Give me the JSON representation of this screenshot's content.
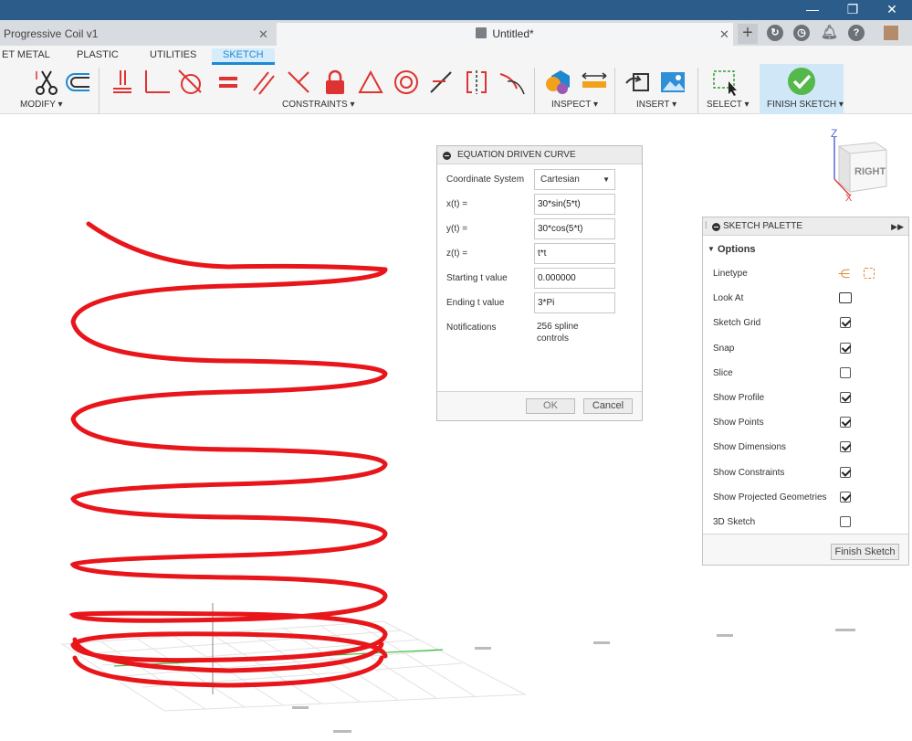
{
  "window": {
    "minimize": "—",
    "restore": "❐",
    "close": "✕"
  },
  "tabs": [
    {
      "label": "Progressive Coil v1",
      "close": "✕"
    },
    {
      "label": "Untitled*",
      "close": "✕"
    }
  ],
  "top_icons": [
    "new-tab-icon",
    "extensions-icon",
    "job-status-icon",
    "notifications-icon",
    "help-icon",
    "user-avatar"
  ],
  "toolbar": {
    "tabs": [
      "ET METAL",
      "PLASTIC",
      "UTILITIES",
      "SKETCH"
    ],
    "active_tab": "SKETCH",
    "groups": {
      "modify": "MODIFY ▾",
      "constraints": "CONSTRAINTS ▾",
      "inspect": "INSPECT ▾",
      "insert": "INSERT ▾",
      "select": "SELECT ▾",
      "finish": "FINISH SKETCH ▾"
    },
    "accent": "#1a8ad4"
  },
  "equation_dialog": {
    "title": "EQUATION DRIVEN CURVE",
    "coordinate_system_label": "Coordinate System",
    "coordinate_system_value": "Cartesian",
    "x_label": "x(t) =",
    "x_value": "30*sin(5*t)",
    "y_label": "y(t) =",
    "y_value": "30*cos(5*t)",
    "z_label": "z(t) =",
    "z_value": "t*t",
    "start_label": "Starting t value",
    "start_value": "0.000000",
    "end_label": "Ending t value",
    "end_value": "3*Pi",
    "notifications_label": "Notifications",
    "notifications_value": "256 spline controls",
    "ok": "OK",
    "cancel": "Cancel"
  },
  "sketch_palette": {
    "title": "SKETCH PALETTE",
    "options_label": "Options",
    "rows": [
      {
        "label": "Linetype",
        "kind": "linetype"
      },
      {
        "label": "Look At",
        "kind": "lookat"
      },
      {
        "label": "Sketch Grid",
        "kind": "check",
        "checked": true
      },
      {
        "label": "Snap",
        "kind": "check",
        "checked": true
      },
      {
        "label": "Slice",
        "kind": "check",
        "checked": false
      },
      {
        "label": "Show Profile",
        "kind": "check",
        "checked": true
      },
      {
        "label": "Show Points",
        "kind": "check",
        "checked": true
      },
      {
        "label": "Show Dimensions",
        "kind": "check",
        "checked": true
      },
      {
        "label": "Show Constraints",
        "kind": "check",
        "checked": true
      },
      {
        "label": "Show Projected Geometries",
        "kind": "check",
        "checked": true
      },
      {
        "label": "3D Sketch",
        "kind": "check",
        "checked": false
      }
    ],
    "finish_button": "Finish Sketch"
  },
  "viewcube": {
    "face": "RIGHT",
    "z_axis": "Z",
    "x_axis": "X"
  },
  "curve": {
    "color": "#e8161b"
  }
}
